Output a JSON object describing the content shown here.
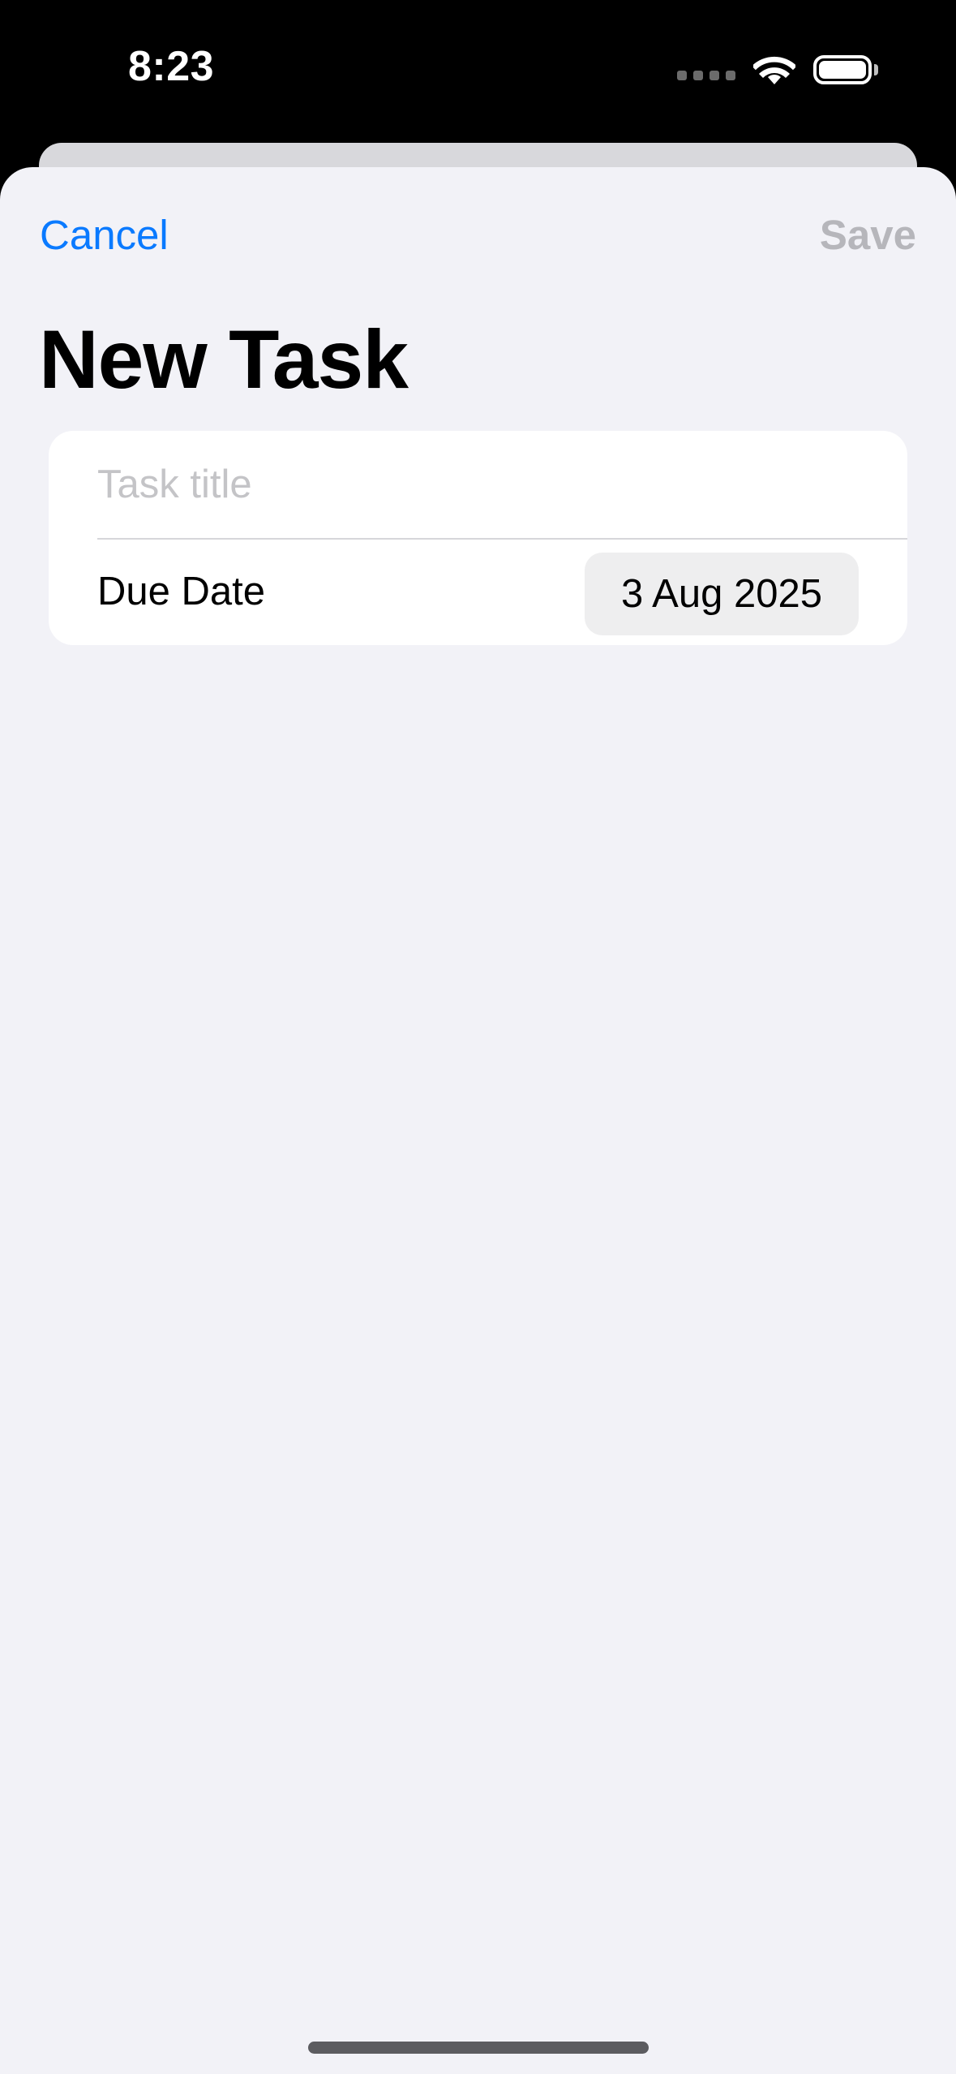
{
  "status_bar": {
    "time": "8:23",
    "icons": [
      "cellular-signal-icon",
      "wifi-icon",
      "battery-icon"
    ]
  },
  "nav": {
    "cancel_label": "Cancel",
    "save_label": "Save",
    "title": "New Task"
  },
  "form": {
    "title_field": {
      "value": "",
      "placeholder": "Task title"
    },
    "due_date": {
      "label": "Due Date",
      "value": "3 Aug 2025"
    }
  },
  "colors": {
    "accent": "#0a7aff",
    "disabled": "#b6b6bb",
    "background": "#f2f2f7",
    "card": "#ffffff"
  }
}
